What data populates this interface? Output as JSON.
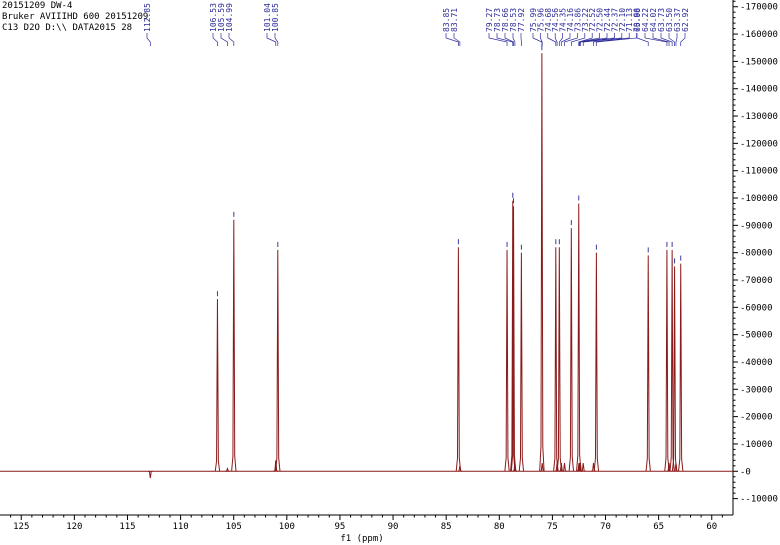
{
  "header": {
    "line1": "20151209 DW-4",
    "line2": "Bruker AVIIIHD 600 20151209",
    "line3": "C13 D2O D:\\\\ DATA2015 28"
  },
  "colors": {
    "spectrum": "#8b1a1a",
    "peak_labels": "#2a2a9a",
    "axis": "#000000",
    "integral_marks": "#3a3aa0"
  },
  "chart_data": {
    "type": "line",
    "title": "",
    "xlabel": "f1 (ppm)",
    "ylabel": "",
    "xlim": [
      127,
      58
    ],
    "ylim": [
      -16000,
      171000
    ],
    "x_reversed": true,
    "x_ticks": [
      125,
      120,
      115,
      110,
      105,
      100,
      95,
      90,
      85,
      80,
      75,
      70,
      65,
      60
    ],
    "y_ticks": [
      -10000,
      0,
      10000,
      20000,
      30000,
      40000,
      50000,
      60000,
      70000,
      80000,
      90000,
      100000,
      110000,
      120000,
      130000,
      140000,
      150000,
      160000,
      170000
    ],
    "y_axis_side": "right",
    "grid": false,
    "peaks": [
      {
        "ppm": 112.85,
        "intensity": -2500
      },
      {
        "ppm": 106.53,
        "intensity": 63000
      },
      {
        "ppm": 105.59,
        "intensity": 1000
      },
      {
        "ppm": 104.99,
        "intensity": 92000
      },
      {
        "ppm": 101.04,
        "intensity": 4000
      },
      {
        "ppm": 100.85,
        "intensity": 81000
      },
      {
        "ppm": 83.85,
        "intensity": 82000
      },
      {
        "ppm": 83.71,
        "intensity": 2000
      },
      {
        "ppm": 79.27,
        "intensity": 81000
      },
      {
        "ppm": 78.73,
        "intensity": 99000
      },
      {
        "ppm": 78.66,
        "intensity": 97000
      },
      {
        "ppm": 78.53,
        "intensity": 3000
      },
      {
        "ppm": 77.92,
        "intensity": 80000
      },
      {
        "ppm": 75.99,
        "intensity": 153000
      },
      {
        "ppm": 75.96,
        "intensity": 3000
      },
      {
        "ppm": 74.68,
        "intensity": 82000
      },
      {
        "ppm": 74.56,
        "intensity": 3000
      },
      {
        "ppm": 74.35,
        "intensity": 82000
      },
      {
        "ppm": 74.16,
        "intensity": 3000
      },
      {
        "ppm": 73.86,
        "intensity": 3000
      },
      {
        "ppm": 73.22,
        "intensity": 89000
      },
      {
        "ppm": 72.52,
        "intensity": 98000
      },
      {
        "ppm": 72.5,
        "intensity": 3000
      },
      {
        "ppm": 72.44,
        "intensity": 3000
      },
      {
        "ppm": 72.37,
        "intensity": 3000
      },
      {
        "ppm": 72.1,
        "intensity": 3000
      },
      {
        "ppm": 71.13,
        "intensity": 3000
      },
      {
        "ppm": 70.86,
        "intensity": 80000
      },
      {
        "ppm": 65.98,
        "intensity": 79000
      },
      {
        "ppm": 64.22,
        "intensity": 81000
      },
      {
        "ppm": 64.02,
        "intensity": 3000
      },
      {
        "ppm": 63.73,
        "intensity": 81000
      },
      {
        "ppm": 63.5,
        "intensity": 75000
      },
      {
        "ppm": 63.37,
        "intensity": 3000
      },
      {
        "ppm": 62.92,
        "intensity": 76000
      }
    ],
    "peak_label_groups": [
      {
        "labels": [
          "112.85"
        ]
      },
      {
        "labels": [
          "106.53",
          "105.59",
          "104.99"
        ]
      },
      {
        "labels": [
          "101.04",
          "100.85"
        ]
      },
      {
        "labels": [
          "83.85",
          "83.71"
        ]
      },
      {
        "labels": [
          "79.27",
          "78.73",
          "78.66",
          "78.53",
          "77.92"
        ]
      },
      {
        "labels": [
          "75.99",
          "75.96",
          "74.68",
          "74.56",
          "74.35",
          "74.16",
          "73.86",
          "73.22",
          "72.52",
          "72.50",
          "72.44",
          "72.37",
          "72.10",
          "71.13",
          "70.86"
        ]
      },
      {
        "labels": [
          "65.98",
          "64.22",
          "64.02",
          "63.73",
          "63.50",
          "63.37",
          "62.92"
        ]
      }
    ]
  }
}
